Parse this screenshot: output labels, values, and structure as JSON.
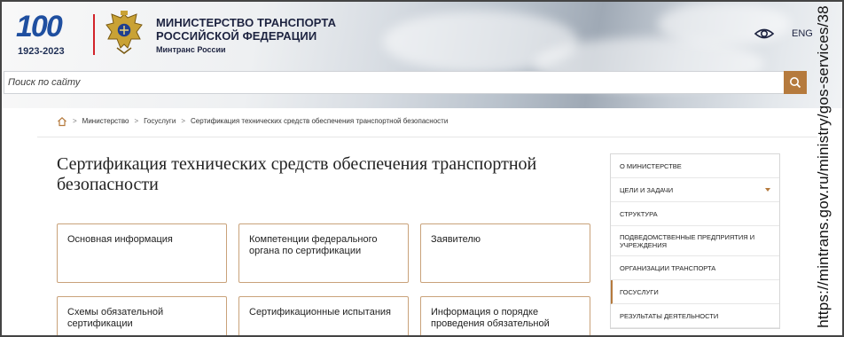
{
  "header": {
    "logo_number": "100",
    "logo_years": "1923-2023",
    "ministry_line1": "МИНИСТЕРСТВО ТРАНСПОРТА",
    "ministry_line2": "РОССИЙСКОЙ ФЕДЕРАЦИИ",
    "ministry_short": "Минтранс России",
    "lang": "ENG",
    "icons": {
      "eye": "eye-icon",
      "search": "search-icon"
    }
  },
  "search": {
    "placeholder": "Поиск по сайту"
  },
  "breadcrumb": {
    "home_icon": "home-icon",
    "items": [
      "Министерство",
      "Госуслуги",
      "Сертификация технических средств обеспечения транспортной безопасности"
    ]
  },
  "page": {
    "title": "Сертификация технических средств обеспечения транспортной безопасности"
  },
  "cards": [
    "Основная информация",
    "Компетенции федерального органа по сертификации",
    "Заявителю",
    "Схемы обязательной сертификации",
    "Сертификационные испытания",
    "Информация о порядке проведения обязательной"
  ],
  "sidebar": {
    "items": [
      "О министерстве",
      "Цели и задачи",
      "Структура",
      "Подведомственные предприятия и учреждения",
      "Организации транспорта",
      "Госуслуги",
      "Результаты деятельности"
    ],
    "active_index": 5
  },
  "vertical_url": "https://mintrans.gov.ru/ministry/gos-services/38",
  "colors": {
    "accent": "#b57a3d",
    "brand_blue": "#1f4fa0",
    "card_border": "#c9a27a"
  }
}
